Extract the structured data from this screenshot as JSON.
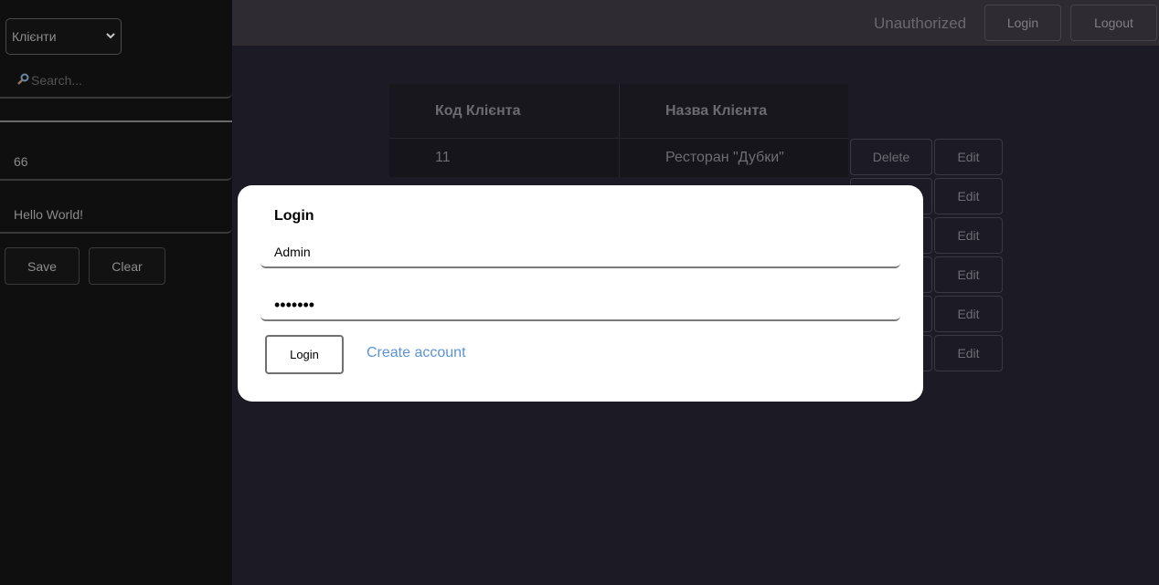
{
  "sidebar": {
    "table_select": {
      "selected": "Клієнти"
    },
    "search": {
      "placeholder": "Search..."
    },
    "fields": {
      "id_value": "66",
      "name_value": "Hello World!"
    },
    "buttons": {
      "save": "Save",
      "clear": "Clear"
    }
  },
  "header": {
    "auth_status": "Unauthorized",
    "login": "Login",
    "logout": "Logout"
  },
  "table": {
    "columns": [
      "Код Клієнта",
      "Назва Клієнта"
    ],
    "rows": [
      {
        "code": "11",
        "name": "Ресторан \"Дубки\""
      }
    ],
    "delete_label": "Delete",
    "edit_label": "Edit"
  },
  "modal": {
    "title": "Login",
    "username": "Admin",
    "password": "•••••••",
    "login_button": "Login",
    "create_account": "Create account"
  },
  "colors": {
    "sidebar_bg": "#0f0f0f",
    "main_bg": "#1c1b25",
    "topbar_bg": "#2e2b33",
    "modal_bg": "#ffffff",
    "link": "#5b93d6"
  }
}
